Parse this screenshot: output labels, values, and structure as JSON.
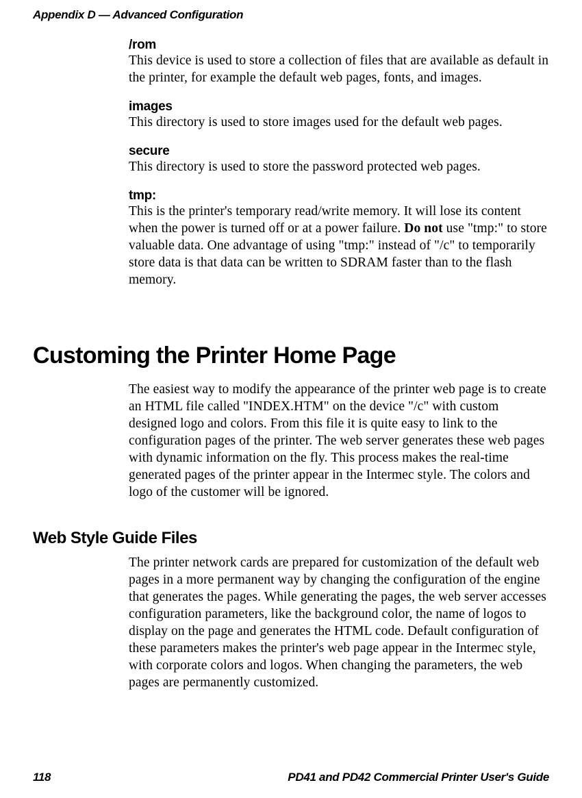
{
  "header": "Appendix D — Advanced Configuration",
  "sections": {
    "rom": {
      "title": "/rom",
      "body": "This device is used to store a collection of files that are available as default in the printer, for example the default web pages, fonts, and images."
    },
    "images": {
      "title": "images",
      "body": "This directory is used to store images used for the default web pages."
    },
    "secure": {
      "title": "secure",
      "body": "This directory is used to store the password protected web pages."
    },
    "tmp": {
      "title": "tmp:",
      "body_before": "This is the printer's temporary read/write memory. It will lose its content when the power is turned off or at a power failure. ",
      "body_bold": "Do not",
      "body_after": " use \"tmp:\" to store valuable data. One advantage of using \"tmp:\" instead of \"/c\" to temporarily store data is that data can be written to SDRAM faster than to the flash memory."
    }
  },
  "heading_customing": "Customing the Printer Home Page",
  "para_customing": "The easiest way to modify the appearance of the printer web page is to create an HTML file called \"INDEX.HTM\" on the device \"/c\" with custom designed logo and colors. From this file it is quite easy to link to the configuration pages of the printer. The web server generates these web pages with dynamic information on the fly. This process makes the real-time generated pages of the printer appear in the Intermec style. The colors and logo of the customer will be ignored.",
  "heading_web": "Web Style Guide Files",
  "para_web": "The printer network cards are prepared for customization of the default web pages in a more permanent way by changing the configuration of the engine that generates the pages. While generating the pages, the web server accesses configuration parameters, like the background color, the name of logos to display on the page and generates the HTML code. Default configuration of these parameters makes the printer's web page appear in the Intermec style, with corporate colors and logos. When changing the parameters, the web pages are permanently customized.",
  "footer": {
    "page": "118",
    "title": "PD41 and PD42 Commercial Printer User's Guide"
  }
}
